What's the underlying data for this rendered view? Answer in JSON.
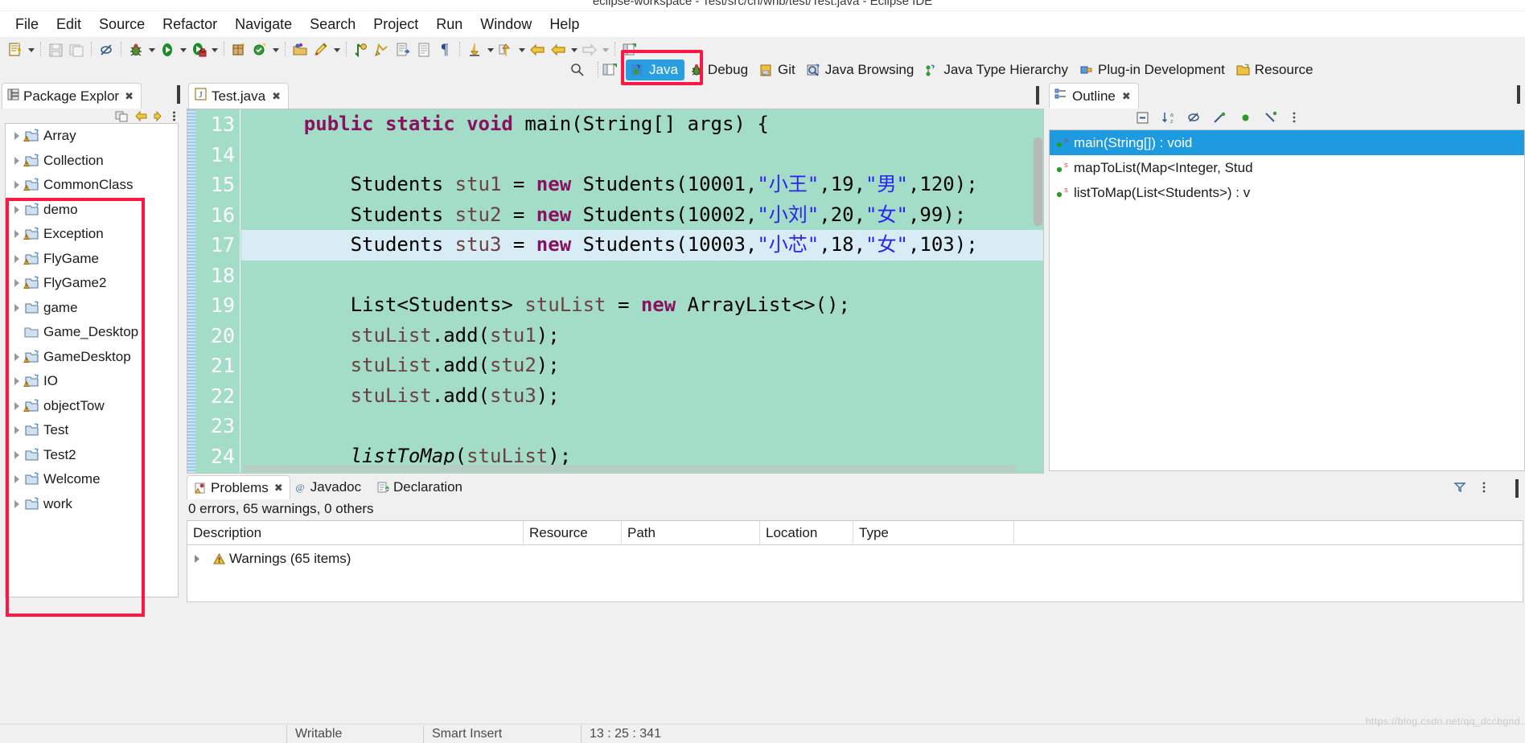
{
  "window": {
    "title": "eclipse-workspace - Test/src/cn/wnb/test/Test.java - Eclipse IDE"
  },
  "menubar": {
    "items": [
      "File",
      "Edit",
      "Source",
      "Refactor",
      "Navigate",
      "Search",
      "Project",
      "Run",
      "Window",
      "Help"
    ]
  },
  "toolbar": {
    "icons": [
      "new-wizard-icon",
      "new-dropdown-arrow",
      "save-icon",
      "save-all-icon",
      "toggle-markers-icon",
      "debug-icon",
      "debug-dropdown-arrow",
      "run-icon",
      "run-dropdown-arrow",
      "coverage-icon",
      "coverage-dropdown-arrow",
      "new-java-package-icon",
      "new-java-class-icon",
      "new-class-dropdown-arrow",
      "open-type-icon",
      "search-icon",
      "search-dropdown-arrow",
      "previous-annotation-icon",
      "next-annotation-icon",
      "last-edit-location-icon",
      "back-icon",
      "back-dropdown-arrow",
      "forward-icon",
      "forward-dropdown-arrow",
      "forward-nav-icon",
      "nav-dropdown-arrow",
      "open-perspective-icon"
    ]
  },
  "perspectives": {
    "search_icon": "quick-access-search-icon",
    "open_perspective_icon": "open-perspective-icon",
    "items": [
      {
        "label": "Java",
        "icon": "java-perspective-icon",
        "active": true
      },
      {
        "label": "Debug",
        "icon": "debug-perspective-icon",
        "active": false
      },
      {
        "label": "Git",
        "icon": "git-perspective-icon",
        "active": false
      },
      {
        "label": "Java Browsing",
        "icon": "java-browsing-perspective-icon",
        "active": false
      },
      {
        "label": "Java Type Hierarchy",
        "icon": "java-type-hierarchy-perspective-icon",
        "active": false
      },
      {
        "label": "Plug-in Development",
        "icon": "plugin-development-perspective-icon",
        "active": false
      },
      {
        "label": "Resource",
        "icon": "resource-perspective-icon",
        "active": false
      }
    ]
  },
  "package_explorer": {
    "tab_label": "Package Explor",
    "tab_icon": "package-explorer-icon",
    "close_icon": "close-icon",
    "minimize_icon": "minimize-icon",
    "maximize_icon": "maximize-icon",
    "toolbar_icons": [
      "link-with-editor-icon",
      "back-icon",
      "forward-icon",
      "collapse-all-icon",
      "view-menu-icon"
    ],
    "items": [
      {
        "label": "Array",
        "icon": "java-project-warning-icon",
        "expandable": true
      },
      {
        "label": "Collection",
        "icon": "java-project-warning-icon",
        "expandable": true
      },
      {
        "label": "CommonClass",
        "icon": "java-project-warning-icon",
        "expandable": true
      },
      {
        "label": "demo",
        "icon": "java-project-icon",
        "expandable": true
      },
      {
        "label": "Exception",
        "icon": "java-project-warning-icon",
        "expandable": true
      },
      {
        "label": "FlyGame",
        "icon": "java-project-warning-icon",
        "expandable": true
      },
      {
        "label": "FlyGame2",
        "icon": "java-project-warning-icon",
        "expandable": true
      },
      {
        "label": "game",
        "icon": "java-project-icon",
        "expandable": true
      },
      {
        "label": "Game_Desktop",
        "icon": "closed-project-icon",
        "expandable": false
      },
      {
        "label": "GameDesktop",
        "icon": "java-project-warning-icon",
        "expandable": true
      },
      {
        "label": "IO",
        "icon": "java-project-warning-icon",
        "expandable": true
      },
      {
        "label": "objectTow",
        "icon": "java-project-warning-icon",
        "expandable": true
      },
      {
        "label": "Test",
        "icon": "java-project-icon",
        "expandable": true
      },
      {
        "label": "Test2",
        "icon": "java-project-icon",
        "expandable": true
      },
      {
        "label": "Welcome",
        "icon": "java-project-icon",
        "expandable": true
      },
      {
        "label": "work",
        "icon": "java-project-icon",
        "expandable": true
      }
    ]
  },
  "editor": {
    "tab_label": "Test.java",
    "tab_icon": "java-file-icon",
    "close_icon": "close-icon",
    "minimize_icon": "minimize-icon",
    "maximize_icon": "maximize-icon",
    "first_line_number": 13,
    "current_line": 17,
    "lines": [
      {
        "n": "13",
        "tokens": [
          {
            "t": "    ",
            "c": ""
          },
          {
            "t": "public static void ",
            "c": "kw"
          },
          {
            "t": "main(String[] args) {",
            "c": ""
          }
        ]
      },
      {
        "n": "14",
        "tokens": [
          {
            "t": "",
            "c": ""
          }
        ]
      },
      {
        "n": "15",
        "tokens": [
          {
            "t": "        Students ",
            "c": ""
          },
          {
            "t": "stu1",
            "c": "fld"
          },
          {
            "t": " = ",
            "c": ""
          },
          {
            "t": "new",
            "c": "kw"
          },
          {
            "t": " Students(10001,",
            "c": ""
          },
          {
            "t": "\"小王\"",
            "c": "str"
          },
          {
            "t": ",19,",
            "c": ""
          },
          {
            "t": "\"男\"",
            "c": "str"
          },
          {
            "t": ",120);",
            "c": ""
          }
        ]
      },
      {
        "n": "16",
        "tokens": [
          {
            "t": "        Students ",
            "c": ""
          },
          {
            "t": "stu2",
            "c": "fld"
          },
          {
            "t": " = ",
            "c": ""
          },
          {
            "t": "new",
            "c": "kw"
          },
          {
            "t": " Students(10002,",
            "c": ""
          },
          {
            "t": "\"小刘\"",
            "c": "str"
          },
          {
            "t": ",20,",
            "c": ""
          },
          {
            "t": "\"女\"",
            "c": "str"
          },
          {
            "t": ",99);",
            "c": ""
          }
        ]
      },
      {
        "n": "17",
        "tokens": [
          {
            "t": "        Students ",
            "c": ""
          },
          {
            "t": "stu3",
            "c": "fld"
          },
          {
            "t": " = ",
            "c": ""
          },
          {
            "t": "new",
            "c": "kw"
          },
          {
            "t": " Students(10003,",
            "c": ""
          },
          {
            "t": "\"小芯\"",
            "c": "str"
          },
          {
            "t": ",18,",
            "c": ""
          },
          {
            "t": "\"女\"",
            "c": "str"
          },
          {
            "t": ",103);",
            "c": ""
          }
        ]
      },
      {
        "n": "18",
        "tokens": [
          {
            "t": "",
            "c": ""
          }
        ]
      },
      {
        "n": "19",
        "tokens": [
          {
            "t": "        List<Students> ",
            "c": ""
          },
          {
            "t": "stuList",
            "c": "fld"
          },
          {
            "t": " = ",
            "c": ""
          },
          {
            "t": "new",
            "c": "kw"
          },
          {
            "t": " ArrayList<>();",
            "c": ""
          }
        ]
      },
      {
        "n": "20",
        "tokens": [
          {
            "t": "        ",
            "c": ""
          },
          {
            "t": "stuList",
            "c": "fld"
          },
          {
            "t": ".add(",
            "c": ""
          },
          {
            "t": "stu1",
            "c": "fld"
          },
          {
            "t": ");",
            "c": ""
          }
        ]
      },
      {
        "n": "21",
        "tokens": [
          {
            "t": "        ",
            "c": ""
          },
          {
            "t": "stuList",
            "c": "fld"
          },
          {
            "t": ".add(",
            "c": ""
          },
          {
            "t": "stu2",
            "c": "fld"
          },
          {
            "t": ");",
            "c": ""
          }
        ]
      },
      {
        "n": "22",
        "tokens": [
          {
            "t": "        ",
            "c": ""
          },
          {
            "t": "stuList",
            "c": "fld"
          },
          {
            "t": ".add(",
            "c": ""
          },
          {
            "t": "stu3",
            "c": "fld"
          },
          {
            "t": ");",
            "c": ""
          }
        ]
      },
      {
        "n": "23",
        "tokens": [
          {
            "t": "",
            "c": ""
          }
        ]
      },
      {
        "n": "24",
        "tokens": [
          {
            "t": "        ",
            "c": ""
          },
          {
            "t": "listToMap",
            "c": "mth"
          },
          {
            "t": "(",
            "c": ""
          },
          {
            "t": "stuList",
            "c": "fld"
          },
          {
            "t": ");",
            "c": ""
          }
        ]
      }
    ]
  },
  "outline": {
    "tab_label": "Outline",
    "tab_icon": "outline-icon",
    "close_icon": "close-icon",
    "minimize_icon": "minimize-icon",
    "maximize_icon": "maximize-icon",
    "toolbar_icons": [
      "collapse-all-icon",
      "sort-icon",
      "hide-fields-icon",
      "hide-static-icon",
      "hide-non-public-icon",
      "hide-local-types-icon",
      "view-menu-icon"
    ],
    "items": [
      {
        "label": "main(String[]) : void",
        "icon": "public-static-method-icon",
        "selected": true
      },
      {
        "label": "mapToList(Map<Integer, Stud",
        "icon": "public-static-method-icon",
        "selected": false
      },
      {
        "label": "listToMap(List<Students>) : v",
        "icon": "public-static-method-icon",
        "selected": false
      }
    ]
  },
  "problems": {
    "tabs": [
      {
        "label": "Problems",
        "icon": "problems-icon",
        "active": true,
        "close_icon": "close-icon"
      },
      {
        "label": "Javadoc",
        "icon": "javadoc-icon",
        "active": false
      },
      {
        "label": "Declaration",
        "icon": "declaration-icon",
        "active": false
      }
    ],
    "toolbar_icons": [
      "filter-icon",
      "view-menu-icon",
      "minimize-icon",
      "maximize-icon"
    ],
    "summary": "0 errors, 65 warnings, 0 others",
    "columns": [
      "Description",
      "Resource",
      "Path",
      "Location",
      "Type"
    ],
    "rows": [
      {
        "description": "Warnings (65 items)",
        "icon": "warning-icon",
        "resource": "",
        "path": "",
        "location": "",
        "type": ""
      }
    ]
  },
  "statusbar": {
    "writable": "Writable",
    "insert_mode": "Smart Insert",
    "position": "13 : 25 : 341"
  },
  "colors": {
    "accent_blue": "#2a9fe0",
    "highlight_red": "#ff1744",
    "editor_bg": "#a3dcc7",
    "current_line": "#d8ecf5",
    "keyword": "#8a1060",
    "string": "#2a22ee",
    "field": "#6b4040"
  }
}
